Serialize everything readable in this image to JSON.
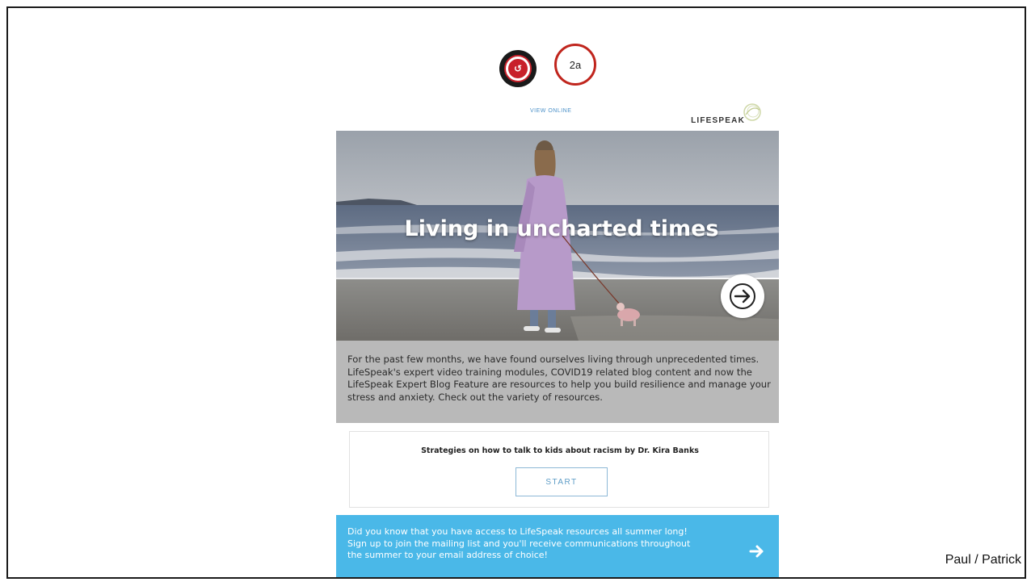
{
  "callout": {
    "label": "2a"
  },
  "email": {
    "view_online": "VIEW ONLINE",
    "brand_name": "LIFESPEAK",
    "hero": {
      "title": "Living in uncharted times"
    },
    "intro_text": "For the past few months, we have found ourselves living through unprecedented times. LifeSpeak's expert video training modules, COVID19 related blog content and now the LifeSpeak Expert Blog Feature are resources to help you build resilience and manage your stress and anxiety. Check out the variety of resources.",
    "card": {
      "title": "Strategies on how to talk to kids about racism by Dr. Kira Banks",
      "button_label": "START"
    },
    "summer_banner": {
      "text": "Did you know that you have access to LifeSpeak resources all summer long! Sign up to join the mailing list and you'll receive communications throughout the summer to your email address of choice!"
    }
  },
  "presenter": "Paul / Patrick",
  "colors": {
    "callout_ring": "#c0251d",
    "logo_red": "#c8202a",
    "banner_blue": "#4ab8e8",
    "intro_gray": "#b9b9b9"
  }
}
